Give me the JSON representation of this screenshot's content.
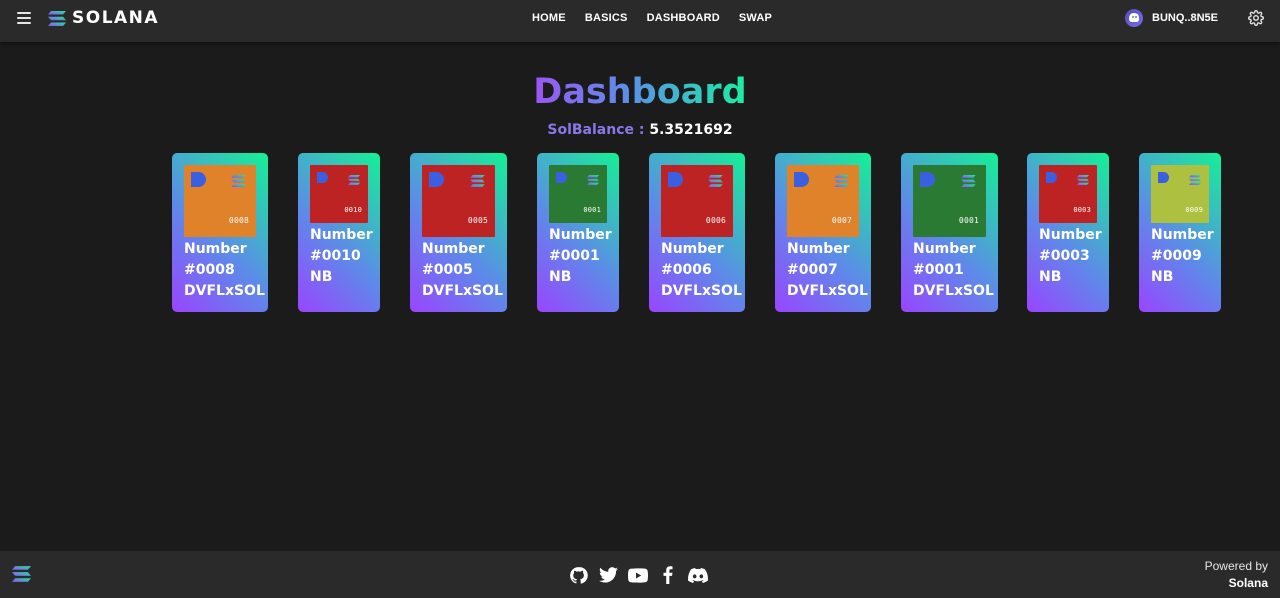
{
  "header": {
    "brand": "SOLANA",
    "nav": [
      "HOME",
      "BASICS",
      "DASHBOARD",
      "SWAP"
    ],
    "wallet": "BUNQ..8N5E"
  },
  "main": {
    "title": "Dashboard",
    "balance_label": "SolBalance :",
    "balance_value": "5.3521692"
  },
  "nfts": [
    {
      "line1": "Number",
      "line2": "#0008",
      "line3": "DVFLxSOL",
      "tag": "0008",
      "color": "#e0822a",
      "logo_color": "#3a5fe0"
    },
    {
      "line1": "Number",
      "line2": "#0010",
      "line3": "NB",
      "tag": "0010",
      "color": "#be2323",
      "logo_color": "#3a5fe0"
    },
    {
      "line1": "Number",
      "line2": "#0005",
      "line3": "DVFLxSOL",
      "tag": "0005",
      "color": "#be2323",
      "logo_color": "#3a5fe0"
    },
    {
      "line1": "Number",
      "line2": "#0001",
      "line3": "NB",
      "tag": "0001",
      "color": "#2b7a33",
      "logo_color": "#3a5fe0"
    },
    {
      "line1": "Number",
      "line2": "#0006",
      "line3": "DVFLxSOL",
      "tag": "0006",
      "color": "#be2323",
      "logo_color": "#3a5fe0"
    },
    {
      "line1": "Number",
      "line2": "#0007",
      "line3": "DVFLxSOL",
      "tag": "0007",
      "color": "#e0822a",
      "logo_color": "#3a5fe0"
    },
    {
      "line1": "Number",
      "line2": "#0001",
      "line3": "DVFLxSOL",
      "tag": "0001",
      "color": "#2b7a33",
      "logo_color": "#3a5fe0"
    },
    {
      "line1": "Number",
      "line2": "#0003",
      "line3": "NB",
      "tag": "0003",
      "color": "#be2323",
      "logo_color": "#3a5fe0"
    },
    {
      "line1": "Number",
      "line2": "#0009",
      "line3": "NB",
      "tag": "0009",
      "color": "#adc03f",
      "logo_color": "#3a5fe0"
    }
  ],
  "footer": {
    "social_icons": [
      "github-icon",
      "twitter-icon",
      "youtube-icon",
      "facebook-icon",
      "discord-icon"
    ],
    "powered_by": "Powered by",
    "powered_name": "Solana"
  },
  "colors": {
    "background": "#1b1b1b",
    "bar": "#2a2a2a",
    "gradient_start": "#9945ff",
    "gradient_end": "#14f195"
  }
}
